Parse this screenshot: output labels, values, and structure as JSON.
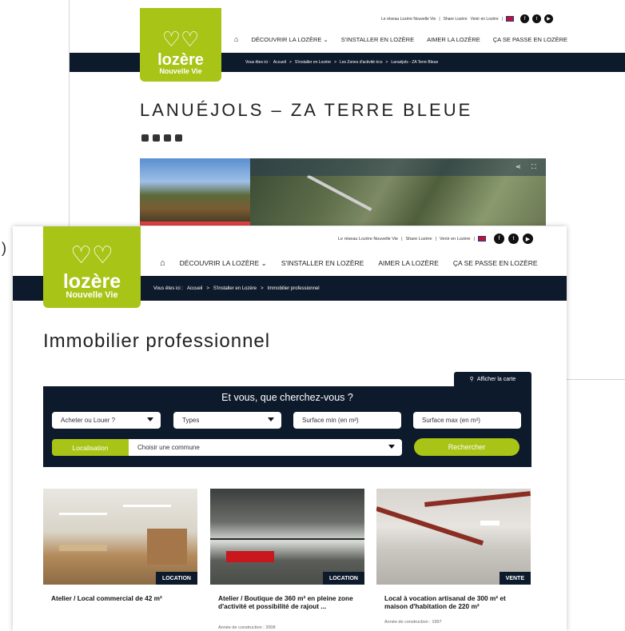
{
  "back": {
    "logo": {
      "line1": "lozère",
      "line2": "Nouvelle Vie"
    },
    "toplinks": [
      "Le réseau Lozère Nouvelle Vie",
      "|",
      "Share Lozère",
      "Venir en Lozère",
      "|"
    ],
    "nav": [
      "DÉCOUVRIR LA LOZÈRE ⌄",
      "S'INSTALLER EN LOZÈRE",
      "AIMER LA LOZÈRE",
      "ÇA SE PASSE EN LOZÈRE"
    ],
    "breadcrumb": [
      "Vous êtes ici :",
      "Accueil",
      ">",
      "S'installer en Lozère",
      ">",
      "Les Zones d'activité éco",
      ">",
      "Lanuéjols - ZA Terre Bleue"
    ],
    "title": "LANUÉJOLS – ZA TERRE BLEUE"
  },
  "paren": ")",
  "front": {
    "logo": {
      "line1": "lozère",
      "line2": "Nouvelle Vie"
    },
    "toplinks": [
      "Le réseau Lozère Nouvelle Vie",
      "|",
      "Share Lozère",
      "|",
      "Venir en Lozère",
      "|"
    ],
    "nav": [
      "DÉCOUVRIR LA LOZÈRE ⌄",
      "S'INSTALLER EN LOZÈRE",
      "AIMER LA LOZÈRE",
      "ÇA SE PASSE EN LOZÈRE"
    ],
    "breadcrumb": [
      "Vous êtes ici :",
      "Accueil",
      ">",
      "S'installer en Lozère",
      ">",
      "Immobilier professionnel"
    ],
    "title": "Immobilier professionnel",
    "map_button": "Afficher la carte",
    "search": {
      "question": "Et vous, que cherchez-vous ?",
      "buy_rent": "Acheter ou Louer ?",
      "types": "Types",
      "surface_min": "Surface min (en m²)",
      "surface_max": "Surface max (en m²)",
      "location_label": "Localisation",
      "commune": "Choisir une commune",
      "submit": "Rechercher"
    },
    "cards": [
      {
        "badge": "LOCATION",
        "title": "Atelier / Local commercial de 42 m²",
        "sub": ""
      },
      {
        "badge": "LOCATION",
        "title": "Atelier / Boutique de 360 m² en pleine zone d'activité et possibilité de rajout ...",
        "sub": "Année de construction : 2008"
      },
      {
        "badge": "VENTE",
        "title": "Local à vocation artisanal de 300 m² et maison d'habitation de 220 m²",
        "sub": "Année de construction : 1997"
      }
    ]
  },
  "colors": {
    "brand_green": "#a8c417",
    "navy": "#0d1a2b"
  }
}
